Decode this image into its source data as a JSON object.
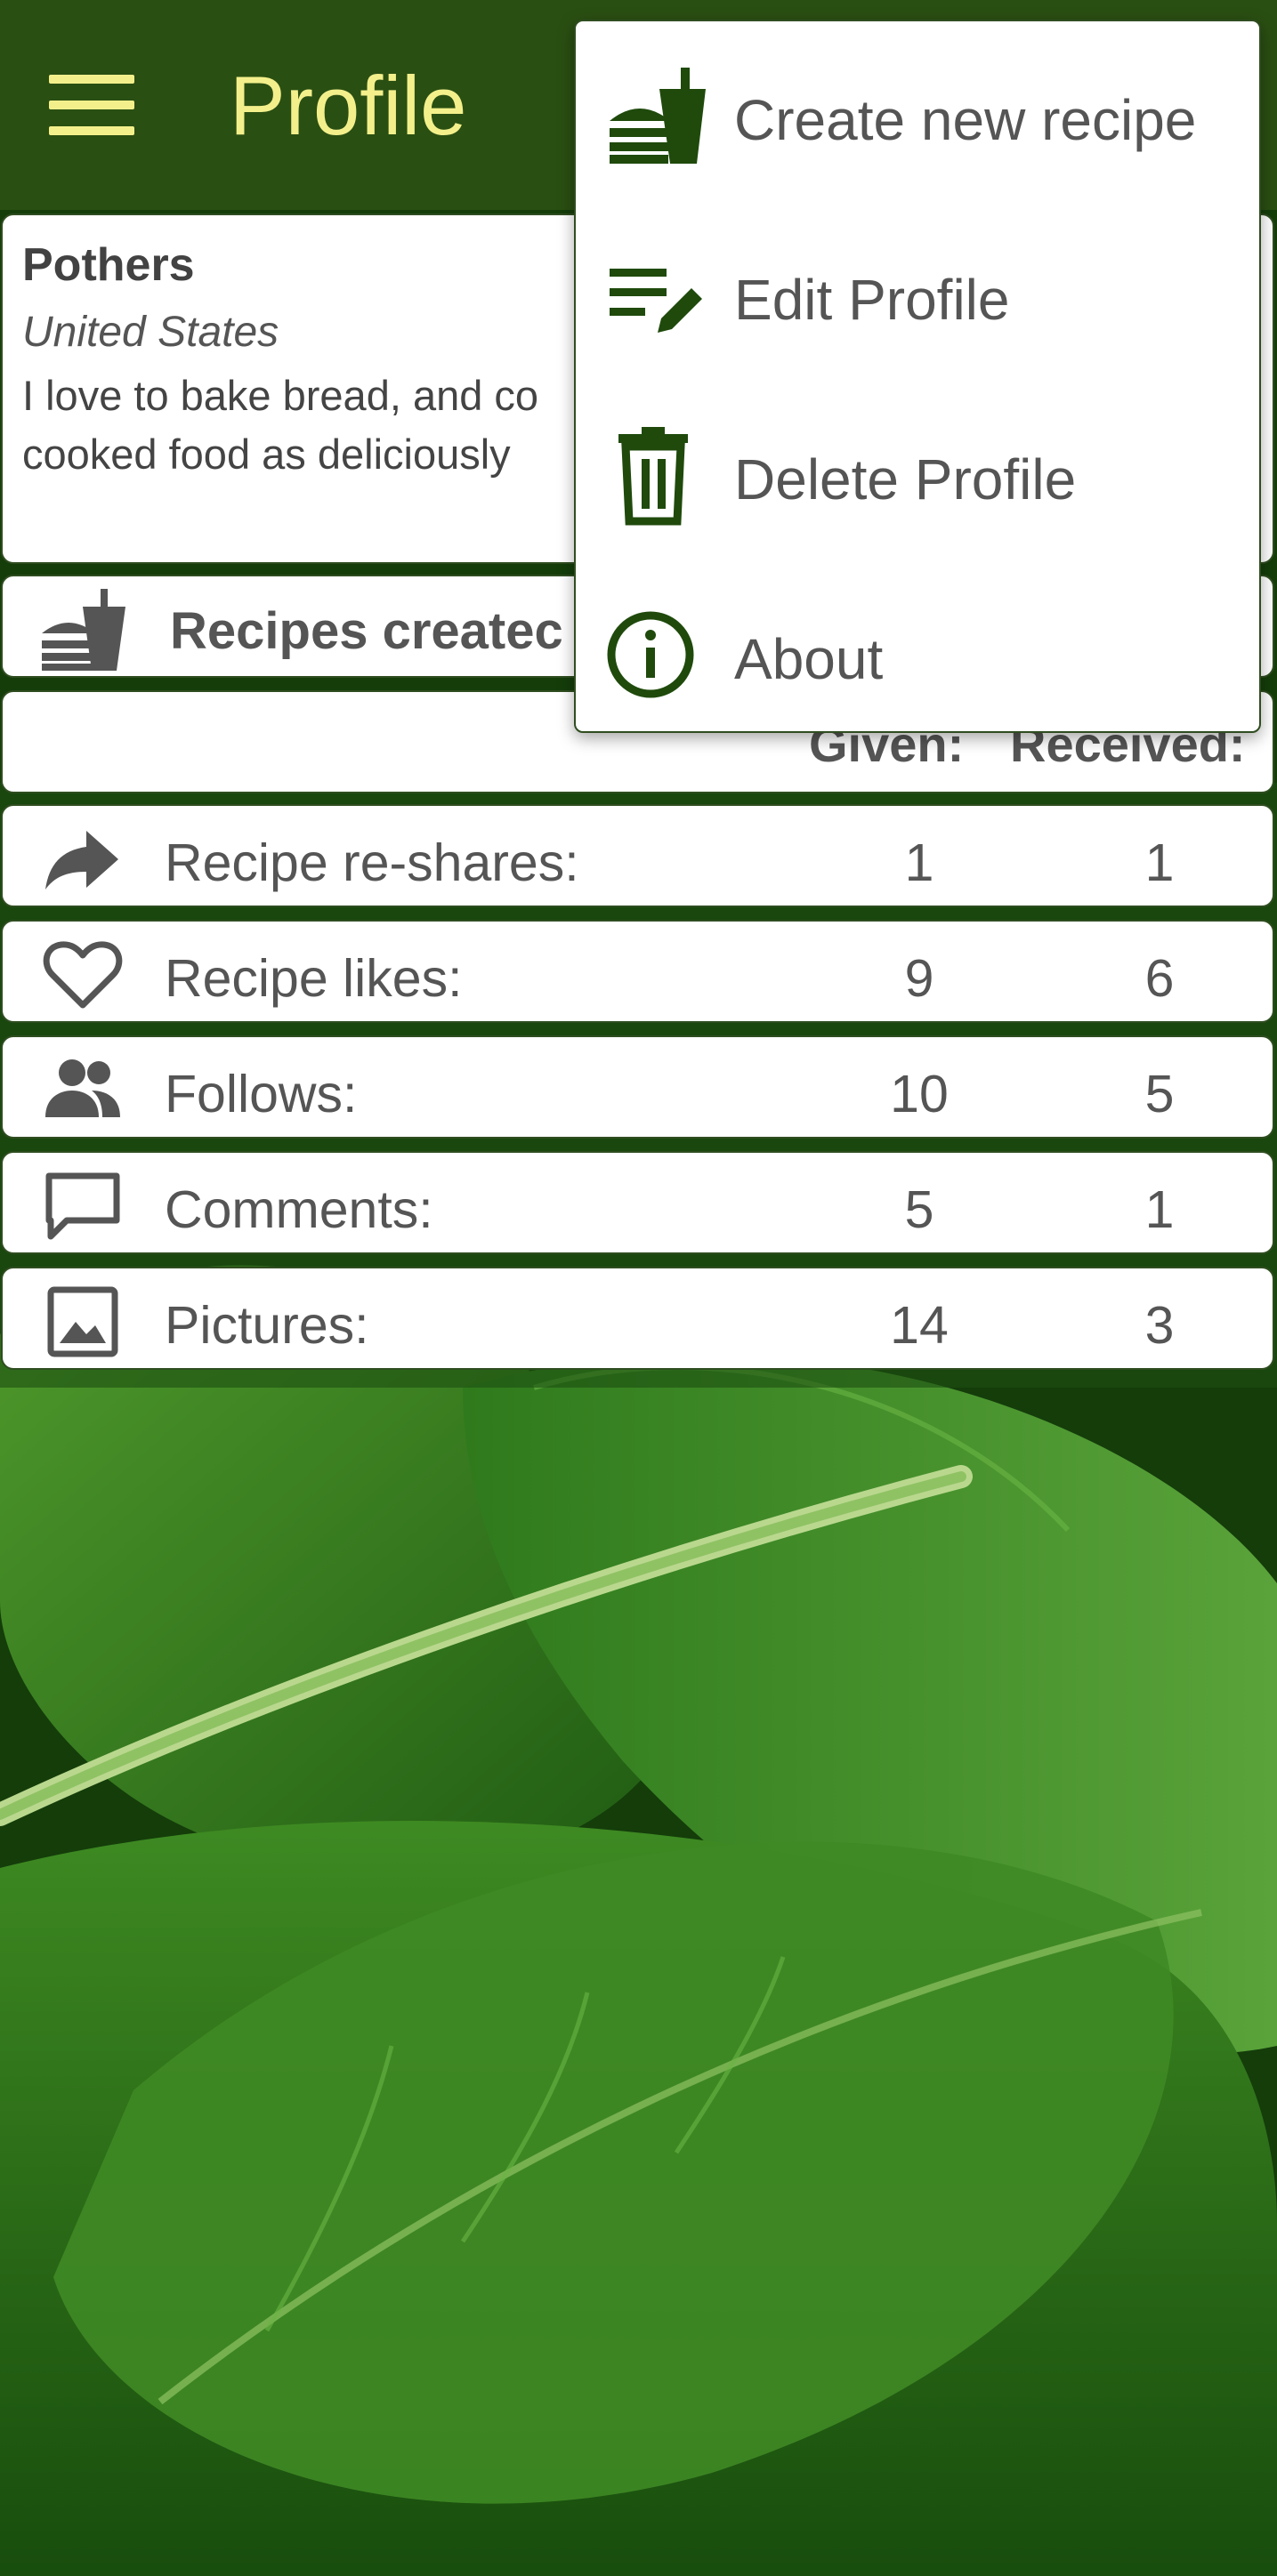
{
  "app_bar": {
    "title": "Profile",
    "menu_icon": "hamburger-menu-icon",
    "background": "#2a4f12",
    "title_color": "#f3f08c"
  },
  "profile": {
    "name": "Pothers",
    "country": "United States",
    "bio_line1": "I love to bake bread, and co",
    "bio_line2": "cooked food as deliciously"
  },
  "recipes_created": {
    "icon": "burger-flag-icon",
    "label": "Recipes createc"
  },
  "stats_header": {
    "given": "Given:",
    "received": "Received:"
  },
  "stats": [
    {
      "icon": "share-arrow-icon",
      "label": "Recipe re-shares:",
      "given": "1",
      "received": "1"
    },
    {
      "icon": "heart-outline-icon",
      "label": "Recipe likes:",
      "given": "9",
      "received": "6"
    },
    {
      "icon": "people-icon",
      "label": "Follows:",
      "given": "10",
      "received": "5"
    },
    {
      "icon": "comment-bubble-icon",
      "label": "Comments:",
      "given": "5",
      "received": "1"
    },
    {
      "icon": "image-icon",
      "label": "Pictures:",
      "given": "14",
      "received": "3"
    }
  ],
  "overflow_menu": {
    "items": [
      {
        "icon": "burger-flag-icon",
        "label": "Create new recipe"
      },
      {
        "icon": "edit-list-icon",
        "label": "Edit Profile"
      },
      {
        "icon": "trash-icon",
        "label": "Delete Profile"
      },
      {
        "icon": "info-icon",
        "label": "About"
      }
    ],
    "icon_color": "#1f4a0c"
  }
}
